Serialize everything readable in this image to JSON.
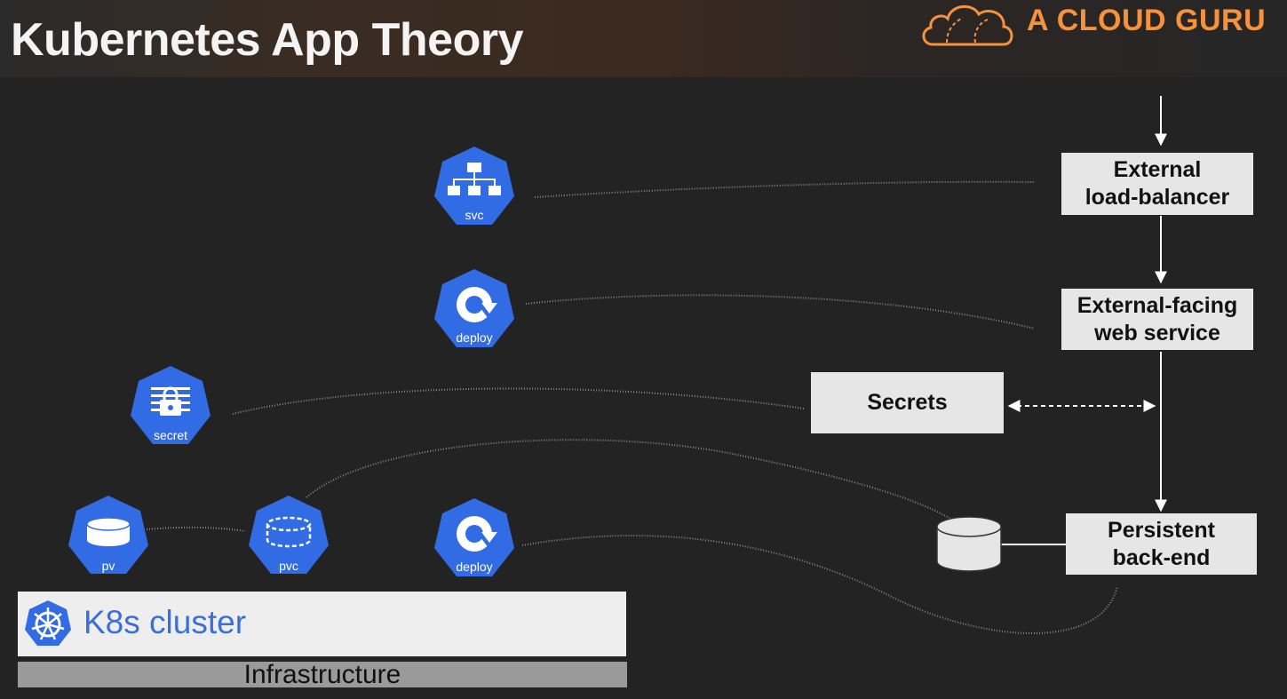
{
  "header": {
    "title": "Kubernetes App Theory",
    "brand": "A CLOUD GURU",
    "brand_color": "#f7923a"
  },
  "k8s_nodes": [
    {
      "label": "svc",
      "icon": "network-hierarchy-icon"
    },
    {
      "label": "deploy",
      "icon": "rotate-arrow-icon"
    },
    {
      "label": "secret",
      "icon": "lock-icon"
    },
    {
      "label": "pv",
      "icon": "disk-icon"
    },
    {
      "label": "pvc",
      "icon": "dashed-disk-icon"
    },
    {
      "label": "deploy",
      "icon": "rotate-arrow-icon"
    }
  ],
  "app_boxes": {
    "load_balancer": "External\nload-balancer",
    "web_service": "External-facing\nweb service",
    "secrets": "Secrets",
    "backend": "Persistent\nback-end"
  },
  "cluster": {
    "label": "K8s cluster",
    "icon": "kubernetes-wheel-icon",
    "infrastructure": "Infrastructure"
  },
  "colors": {
    "k8s_blue": "#326ce5",
    "box_fill": "#e6e6e6"
  }
}
